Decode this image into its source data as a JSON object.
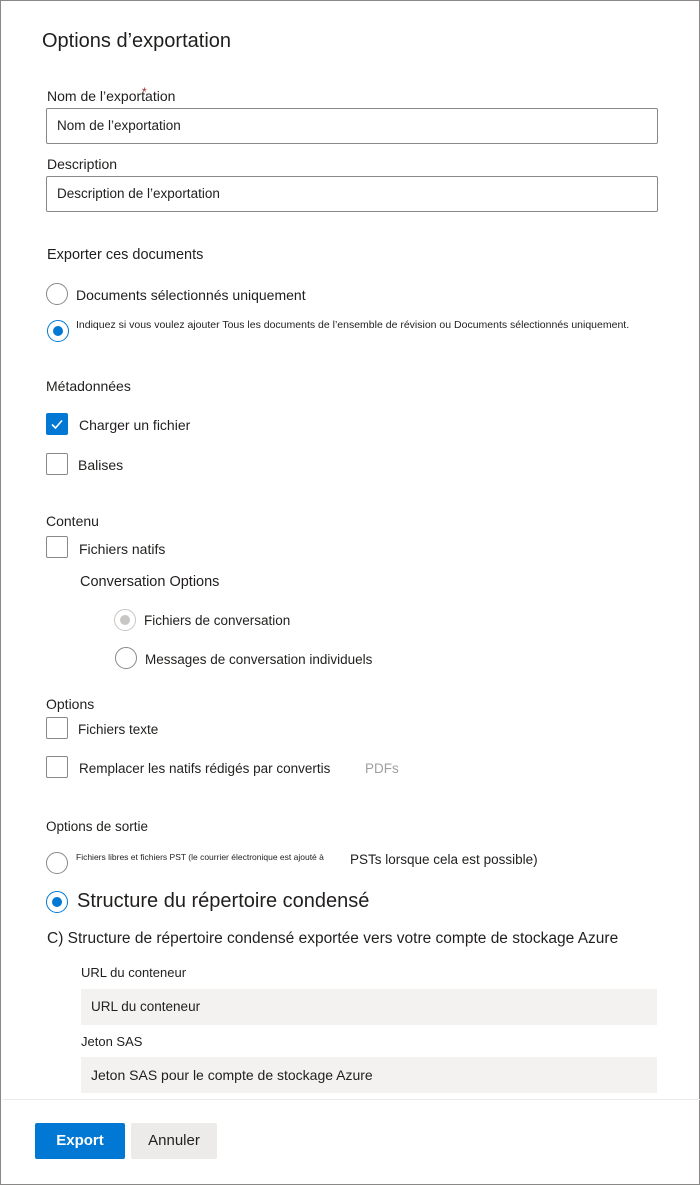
{
  "dialog": {
    "title": "Options d’exportation"
  },
  "export_name": {
    "label": "Nom de l’exportation",
    "required_marker": "*",
    "value": "Nom de l’exportation"
  },
  "description": {
    "label": "Description",
    "value": "Description de l’exportation"
  },
  "documents": {
    "heading": "Exporter ces documents",
    "option_selected_only": "Documents sélectionnés uniquement",
    "option_all": "Indiquez si vous voulez ajouter Tous les documents de l’ensemble de révision ou Documents sélectionnés uniquement.",
    "selected": "option_all"
  },
  "metadata": {
    "heading": "Métadonnées",
    "load_file": {
      "label": "Charger un fichier",
      "checked": true
    },
    "tags": {
      "label": "Balises",
      "checked": false
    }
  },
  "content": {
    "heading": "Contenu",
    "native_files": {
      "label": "Fichiers natifs",
      "checked": false
    },
    "conversation_options_heading": "Conversation Options",
    "conversation_files": "Fichiers de conversation",
    "individual_messages": "Messages de conversation individuels"
  },
  "options": {
    "heading": "Options",
    "text_files": {
      "label": "Fichiers texte",
      "checked": false
    },
    "replace_redacted": {
      "label": "Remplacer les natifs rédigés par convertis",
      "suffix": "PDFs",
      "checked": false
    }
  },
  "output": {
    "heading": "Options de sortie",
    "loose_pst_small": "Fichiers libres et fichiers PST (le courrier électronique est ajouté à",
    "loose_pst_rest": "PSTs lorsque cela est possible)",
    "condensed": "Structure du répertoire condensé",
    "azure": "C) Structure de répertoire condensé exportée vers votre compte de stockage Azure",
    "selected": "condensed"
  },
  "container_url": {
    "label": "URL du conteneur",
    "value": "URL du conteneur"
  },
  "sas_token": {
    "label": "Jeton SAS",
    "value": "Jeton SAS pour le compte de stockage Azure"
  },
  "footer": {
    "export_label": "Export",
    "cancel_label": "Annuler"
  },
  "colors": {
    "accent": "#0078d4",
    "border": "#8a8886",
    "input_grey": "#f3f2f1"
  },
  "icons": {
    "checkmark": "checkmark-icon"
  }
}
